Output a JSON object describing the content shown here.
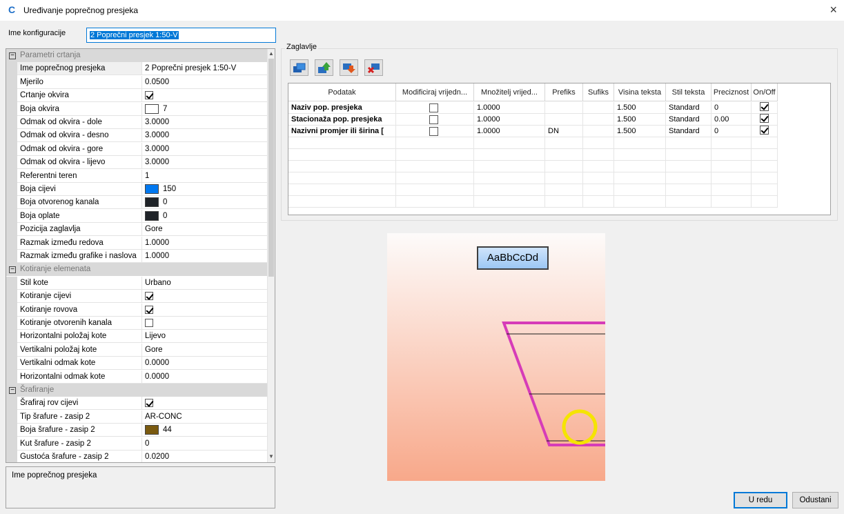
{
  "window": {
    "title": "Uređivanje poprečnog presjeka",
    "close_icon": "×"
  },
  "config": {
    "label": "Ime konfiguracije",
    "value": "2 Poprečni presjek 1:50-V"
  },
  "categories": {
    "drawing": "Parametri crtanja",
    "dimensioning": "Kotiranje elemenata",
    "hatching": "Šrafiranje"
  },
  "drawing_props": [
    {
      "name": "Ime poprečnog presjeka",
      "value": "2 Poprečni presjek 1:50-V"
    },
    {
      "name": "Mjerilo",
      "value": "0.0500"
    },
    {
      "name": "Crtanje okvira",
      "checked": true
    },
    {
      "name": "Boja okvira",
      "value": "7",
      "color": "#ffffff"
    },
    {
      "name": "Odmak od okvira - dole",
      "value": "3.0000"
    },
    {
      "name": "Odmak od okvira - desno",
      "value": "3.0000"
    },
    {
      "name": "Odmak od okvira - gore",
      "value": "3.0000"
    },
    {
      "name": "Odmak od okvira - lijevo",
      "value": "3.0000"
    },
    {
      "name": "Referentni teren",
      "value": "1"
    },
    {
      "name": "Boja cijevi",
      "value": "150",
      "color": "#0078f0"
    },
    {
      "name": "Boja otvorenog kanala",
      "value": "0",
      "color": "#1f2328"
    },
    {
      "name": "Boja oplate",
      "value": "0",
      "color": "#1f2328"
    },
    {
      "name": "Pozicija zaglavlja",
      "value": "Gore"
    },
    {
      "name": "Razmak između redova",
      "value": "1.0000"
    },
    {
      "name": "Razmak između grafike i naslova",
      "value": "1.0000"
    }
  ],
  "dimension_props": [
    {
      "name": "Stil kote",
      "value": "Urbano"
    },
    {
      "name": "Kotiranje cijevi",
      "checked": true
    },
    {
      "name": "Kotiranje rovova",
      "checked": true
    },
    {
      "name": "Kotiranje otvorenih kanala",
      "checked": false
    },
    {
      "name": "Horizontalni položaj kote",
      "value": "Lijevo"
    },
    {
      "name": "Vertikalni položaj kote",
      "value": "Gore"
    },
    {
      "name": "Vertikalni odmak kote",
      "value": "0.0000"
    },
    {
      "name": "Horizontalni odmak kote",
      "value": "0.0000"
    }
  ],
  "hatch_props": [
    {
      "name": "Šrafiraj rov cijevi",
      "checked": true
    },
    {
      "name": "Tip šrafure - zasip 2",
      "value": "AR-CONC"
    },
    {
      "name": "Boja šrafure - zasip 2",
      "value": "44",
      "color": "#7a5a10"
    },
    {
      "name": "Kut šrafure - zasip 2",
      "value": "0"
    },
    {
      "name": "Gustoća šrafure - zasip 2",
      "value": "0.0200"
    }
  ],
  "description": "Ime poprečnog presjeka",
  "header_group": {
    "label": "Zaglavlje",
    "toolbar_icons": [
      "copy-rows-icon",
      "move-up-icon",
      "move-down-icon",
      "delete-row-icon"
    ]
  },
  "table": {
    "columns": [
      "Podatak",
      "Modificiraj vrijedn...",
      "Množitelj vrijed...",
      "Prefiks",
      "Sufiks",
      "Visina teksta",
      "Stil teksta",
      "Preciznost",
      "On/Off"
    ],
    "rows": [
      {
        "podatak": "Naziv pop. presjeka",
        "modify": false,
        "mult": "1.0000",
        "prefix": "",
        "suffix": "",
        "height": "1.500",
        "style": "Standard",
        "precision": "0",
        "on": true
      },
      {
        "podatak": "Stacionaža pop. presjeka",
        "modify": false,
        "mult": "1.0000",
        "prefix": "",
        "suffix": "",
        "height": "1.500",
        "style": "Standard",
        "precision": "0.00",
        "on": true
      },
      {
        "podatak": "Nazivni promjer ili širina [",
        "modify": false,
        "mult": "1.0000",
        "prefix": "DN",
        "suffix": "",
        "height": "1.500",
        "style": "Standard",
        "precision": "0",
        "on": true
      }
    ]
  },
  "preview": {
    "sample_text": "AaBbCcDd",
    "trench_color": "#d63cb8",
    "pipe_color": "#f5e400"
  },
  "buttons": {
    "ok": "U redu",
    "cancel": "Odustani"
  }
}
